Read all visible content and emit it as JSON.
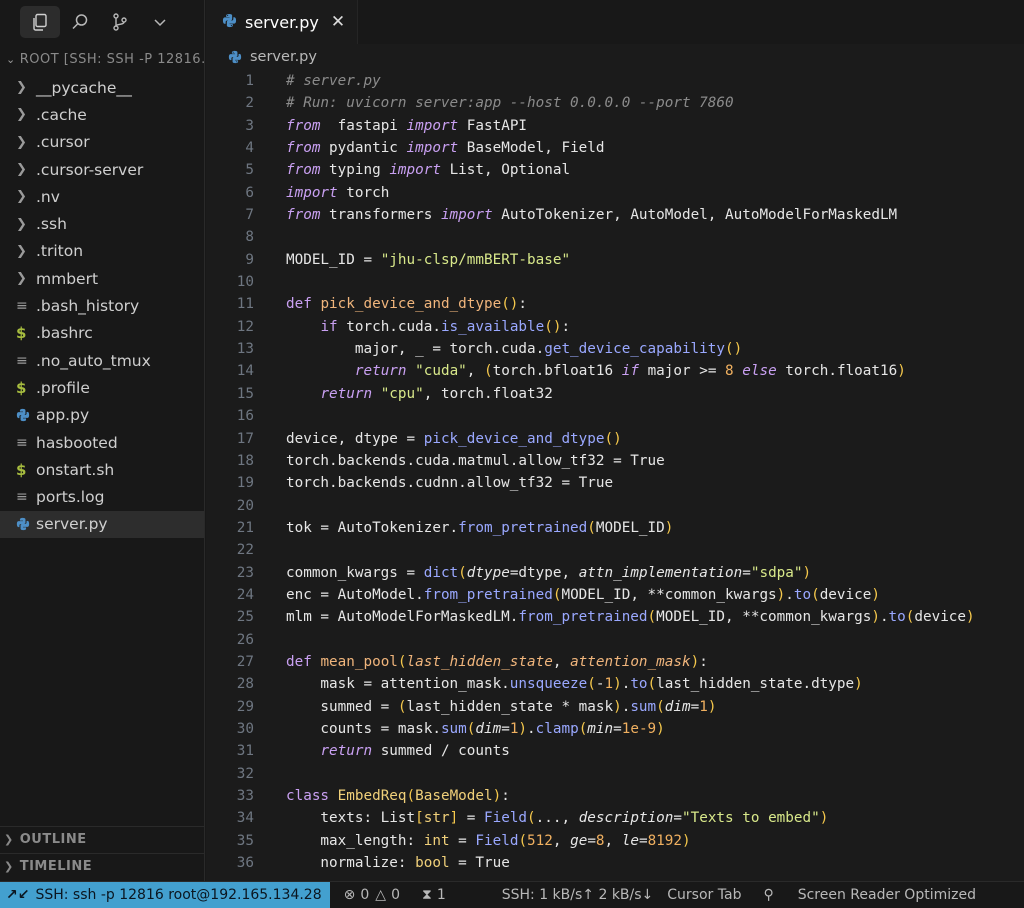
{
  "sidebar": {
    "explorer_title": "ROOT [SSH: SSH -P 12816...",
    "items": [
      {
        "label": "__pycache__",
        "type": "folder"
      },
      {
        "label": ".cache",
        "type": "folder"
      },
      {
        "label": ".cursor",
        "type": "folder"
      },
      {
        "label": ".cursor-server",
        "type": "folder"
      },
      {
        "label": ".nv",
        "type": "folder"
      },
      {
        "label": ".ssh",
        "type": "folder"
      },
      {
        "label": ".triton",
        "type": "folder"
      },
      {
        "label": "mmbert",
        "type": "folder"
      },
      {
        "label": ".bash_history",
        "type": "text"
      },
      {
        "label": ".bashrc",
        "type": "shell"
      },
      {
        "label": ".no_auto_tmux",
        "type": "text"
      },
      {
        "label": ".profile",
        "type": "shell"
      },
      {
        "label": "app.py",
        "type": "python"
      },
      {
        "label": "hasbooted",
        "type": "text"
      },
      {
        "label": "onstart.sh",
        "type": "shell"
      },
      {
        "label": "ports.log",
        "type": "text"
      },
      {
        "label": "server.py",
        "type": "python",
        "selected": true
      }
    ],
    "outline_label": "OUTLINE",
    "timeline_label": "TIMELINE"
  },
  "editor": {
    "tab_label": "server.py",
    "breadcrumb": "server.py",
    "lines": [
      [
        [
          "cm",
          "# server.py"
        ]
      ],
      [
        [
          "cm",
          "# Run: uvicorn server:app --host 0.0.0.0 --port 7860"
        ]
      ],
      [
        [
          "kwi",
          "from"
        ],
        [
          "",
          "  fastapi "
        ],
        [
          "kwi",
          "import"
        ],
        [
          "",
          " FastAPI"
        ]
      ],
      [
        [
          "kwi",
          "from"
        ],
        [
          "",
          " pydantic "
        ],
        [
          "kwi",
          "import"
        ],
        [
          "",
          " BaseModel, Field"
        ]
      ],
      [
        [
          "kwi",
          "from"
        ],
        [
          "",
          " typing "
        ],
        [
          "kwi",
          "import"
        ],
        [
          "",
          " List, Optional"
        ]
      ],
      [
        [
          "kwi",
          "import"
        ],
        [
          "",
          " torch"
        ]
      ],
      [
        [
          "kwi",
          "from"
        ],
        [
          "",
          " transformers "
        ],
        [
          "kwi",
          "import"
        ],
        [
          "",
          " AutoTokenizer, AutoModel, AutoModelForMaskedLM"
        ]
      ],
      [],
      [
        [
          "",
          "MODEL_ID = "
        ],
        [
          "st",
          "\"jhu-clsp/mmBERT-base\""
        ]
      ],
      [],
      [
        [
          "kw",
          "def"
        ],
        [
          "",
          " "
        ],
        [
          "fn",
          "pick_device_and_dtype"
        ],
        [
          "pa",
          "()"
        ],
        [
          "",
          ":"
        ]
      ],
      [
        [
          "",
          "    "
        ],
        [
          "kw",
          "if"
        ],
        [
          "",
          " torch.cuda."
        ],
        [
          "mt",
          "is_available"
        ],
        [
          "pa",
          "()"
        ],
        [
          "",
          ":"
        ]
      ],
      [
        [
          "",
          "        major, _ = torch.cuda."
        ],
        [
          "mt",
          "get_device_capability"
        ],
        [
          "pa",
          "()"
        ]
      ],
      [
        [
          "",
          "        "
        ],
        [
          "kwi",
          "return"
        ],
        [
          "",
          " "
        ],
        [
          "st",
          "\"cuda\""
        ],
        [
          "",
          ", "
        ],
        [
          "pa",
          "("
        ],
        [
          "",
          "torch.bfloat16 "
        ],
        [
          "kwi",
          "if"
        ],
        [
          "",
          " major >= "
        ],
        [
          "nu",
          "8"
        ],
        [
          "",
          " "
        ],
        [
          "kwi",
          "else"
        ],
        [
          "",
          " torch.float16"
        ],
        [
          "pa",
          ")"
        ]
      ],
      [
        [
          "",
          "    "
        ],
        [
          "kwi",
          "return"
        ],
        [
          "",
          " "
        ],
        [
          "st",
          "\"cpu\""
        ],
        [
          "",
          ", torch.float32"
        ]
      ],
      [],
      [
        [
          "",
          "device, dtype = "
        ],
        [
          "mt",
          "pick_device_and_dtype"
        ],
        [
          "pa",
          "()"
        ]
      ],
      [
        [
          "",
          "torch.backends.cuda.matmul.allow_tf32 = True"
        ]
      ],
      [
        [
          "",
          "torch.backends.cudnn.allow_tf32 = True"
        ]
      ],
      [],
      [
        [
          "",
          "tok = AutoTokenizer."
        ],
        [
          "mt",
          "from_pretrained"
        ],
        [
          "pa",
          "("
        ],
        [
          "",
          "MODEL_ID"
        ],
        [
          "pa",
          ")"
        ]
      ],
      [],
      [
        [
          "",
          "common_kwargs = "
        ],
        [
          "mt",
          "dict"
        ],
        [
          "pa",
          "("
        ],
        [
          "ar",
          "dtype"
        ],
        [
          "",
          "=dtype, "
        ],
        [
          "ar",
          "attn_implementation"
        ],
        [
          "",
          "="
        ],
        [
          "st",
          "\"sdpa\""
        ],
        [
          "pa",
          ")"
        ]
      ],
      [
        [
          "",
          "enc = AutoModel."
        ],
        [
          "mt",
          "from_pretrained"
        ],
        [
          "pa",
          "("
        ],
        [
          "",
          "MODEL_ID, **common_kwargs"
        ],
        [
          "pa",
          ")"
        ],
        [
          "",
          "."
        ],
        [
          "mt",
          "to"
        ],
        [
          "pa",
          "("
        ],
        [
          "",
          "device"
        ],
        [
          "pa",
          ")"
        ]
      ],
      [
        [
          "",
          "mlm = AutoModelForMaskedLM."
        ],
        [
          "mt",
          "from_pretrained"
        ],
        [
          "pa",
          "("
        ],
        [
          "",
          "MODEL_ID, **common_kwargs"
        ],
        [
          "pa",
          ")"
        ],
        [
          "",
          "."
        ],
        [
          "mt",
          "to"
        ],
        [
          "pa",
          "("
        ],
        [
          "",
          "device"
        ],
        [
          "pa",
          ")"
        ]
      ],
      [],
      [
        [
          "kw",
          "def"
        ],
        [
          "",
          " "
        ],
        [
          "fn",
          "mean_pool"
        ],
        [
          "pa",
          "("
        ],
        [
          "ps",
          "last_hidden_state"
        ],
        [
          "",
          ", "
        ],
        [
          "ps",
          "attention_mask"
        ],
        [
          "pa",
          ")"
        ],
        [
          "",
          ":"
        ]
      ],
      [
        [
          "",
          "    mask = attention_mask."
        ],
        [
          "mt",
          "unsqueeze"
        ],
        [
          "pa",
          "("
        ],
        [
          "",
          "-"
        ],
        [
          "nu",
          "1"
        ],
        [
          "pa",
          ")"
        ],
        [
          "",
          "."
        ],
        [
          "mt",
          "to"
        ],
        [
          "pa",
          "("
        ],
        [
          "",
          "last_hidden_state.dtype"
        ],
        [
          "pa",
          ")"
        ]
      ],
      [
        [
          "",
          "    summed = "
        ],
        [
          "pa",
          "("
        ],
        [
          "",
          "last_hidden_state * mask"
        ],
        [
          "pa",
          ")"
        ],
        [
          "",
          "."
        ],
        [
          "mt",
          "sum"
        ],
        [
          "pa",
          "("
        ],
        [
          "ar",
          "dim"
        ],
        [
          "",
          "="
        ],
        [
          "nu",
          "1"
        ],
        [
          "pa",
          ")"
        ]
      ],
      [
        [
          "",
          "    counts = mask."
        ],
        [
          "mt",
          "sum"
        ],
        [
          "pa",
          "("
        ],
        [
          "ar",
          "dim"
        ],
        [
          "",
          "="
        ],
        [
          "nu",
          "1"
        ],
        [
          "pa",
          ")"
        ],
        [
          "",
          "."
        ],
        [
          "mt",
          "clamp"
        ],
        [
          "pa",
          "("
        ],
        [
          "ar",
          "min"
        ],
        [
          "",
          "="
        ],
        [
          "nu",
          "1e-9"
        ],
        [
          "pa",
          ")"
        ]
      ],
      [
        [
          "",
          "    "
        ],
        [
          "kwi",
          "return"
        ],
        [
          "",
          " summed / counts"
        ]
      ],
      [],
      [
        [
          "kw",
          "class"
        ],
        [
          "",
          " "
        ],
        [
          "ty",
          "EmbedReq"
        ],
        [
          "pa",
          "("
        ],
        [
          "ty",
          "BaseModel"
        ],
        [
          "pa",
          ")"
        ],
        [
          "",
          ":"
        ]
      ],
      [
        [
          "",
          "    texts: List"
        ],
        [
          "pa",
          "["
        ],
        [
          "ty",
          "str"
        ],
        [
          "pa",
          "]"
        ],
        [
          "",
          " = "
        ],
        [
          "mt",
          "Field"
        ],
        [
          "pa",
          "("
        ],
        [
          "",
          "..., "
        ],
        [
          "ar",
          "description"
        ],
        [
          "",
          "="
        ],
        [
          "st",
          "\"Texts to embed\""
        ],
        [
          "pa",
          ")"
        ]
      ],
      [
        [
          "",
          "    max_length: "
        ],
        [
          "ty",
          "int"
        ],
        [
          "",
          " = "
        ],
        [
          "mt",
          "Field"
        ],
        [
          "pa",
          "("
        ],
        [
          "nu",
          "512"
        ],
        [
          "",
          ", "
        ],
        [
          "ar",
          "ge"
        ],
        [
          "",
          "="
        ],
        [
          "nu",
          "8"
        ],
        [
          "",
          ", "
        ],
        [
          "ar",
          "le"
        ],
        [
          "",
          "="
        ],
        [
          "nu",
          "8192"
        ],
        [
          "pa",
          ")"
        ]
      ],
      [
        [
          "",
          "    normalize: "
        ],
        [
          "ty",
          "bool"
        ],
        [
          "",
          " = True"
        ]
      ]
    ]
  },
  "statusbar": {
    "remote": "SSH: ssh -p 12816 root@192.165.134.28",
    "errors": "0",
    "warnings": "0",
    "ports": "1",
    "transfer": "SSH: 1 kB/s↑ 2 kB/s↓",
    "cursor_tab": "Cursor Tab",
    "screen_reader": "Screen Reader Optimized"
  },
  "colors": {
    "accent": "#43a0cf",
    "background": "#1b1b1b",
    "sidebar": "#181818"
  }
}
